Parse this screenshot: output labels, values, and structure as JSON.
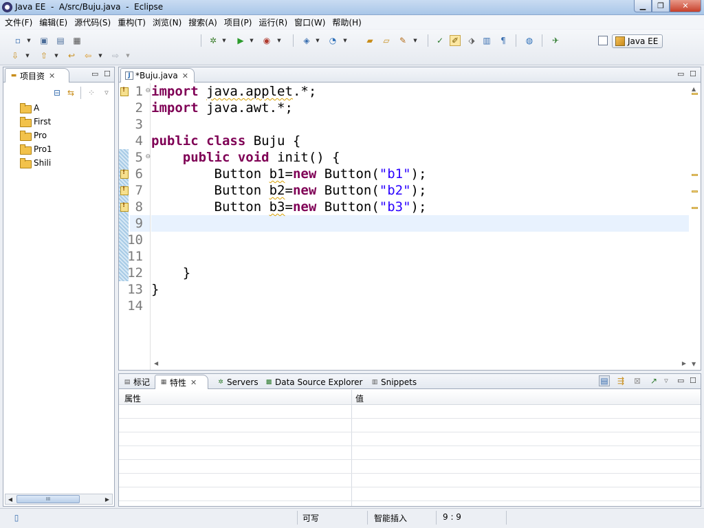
{
  "window": {
    "title": "Java EE  -  A/src/Buju.java  -  Eclipse"
  },
  "menu": [
    "文件(F)",
    "编辑(E)",
    "源代码(S)",
    "重构(T)",
    "浏览(N)",
    "搜索(A)",
    "项目(P)",
    "运行(R)",
    "窗口(W)",
    "帮助(H)"
  ],
  "perspective": {
    "label": "Java EE"
  },
  "explorer": {
    "tab_label": "项目资",
    "projects": [
      "A",
      "First",
      "Pro",
      "Pro1",
      "Shili"
    ],
    "scroll_label": "III"
  },
  "editor": {
    "tab_label": "*Buju.java",
    "line_numbers": [
      "1",
      "2",
      "3",
      "4",
      "5",
      "6",
      "7",
      "8",
      "9",
      "10",
      "11",
      "12",
      "13",
      "14"
    ],
    "current_line": 9,
    "warning_lines": [
      1,
      6,
      7,
      8
    ]
  },
  "bottom_panel": {
    "tabs": [
      "标记",
      "特性",
      "Servers",
      "Data Source Explorer",
      "Snippets"
    ],
    "columns": [
      "属性",
      "值"
    ]
  },
  "statusbar": {
    "writable": "可写",
    "insert_mode": "智能插入",
    "position": "9 : 9"
  },
  "colors": {
    "keyword": "#7F0055",
    "string": "#2A00FF",
    "current_line": "#E8F2FE"
  }
}
